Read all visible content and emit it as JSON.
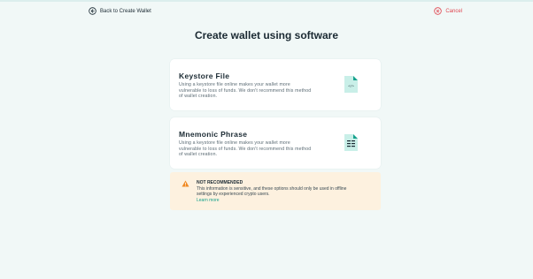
{
  "header": {
    "back_label": "Back to Create Wallet",
    "cancel_label": "Cancel"
  },
  "page": {
    "title": "Create wallet using software"
  },
  "options": [
    {
      "title": "Keystore File",
      "description": "Using a keystore file online makes your wallet more vulnerable to loss of funds. We don't recommend this method of wallet creation.",
      "icon": "keystore-file-icon"
    },
    {
      "title": "Mnemonic Phrase",
      "description": "Using a keystore file online makes your wallet more vulnerable to loss of funds. We don't recommend this method of wallet creation.",
      "icon": "mnemonic-phrase-icon"
    }
  ],
  "warning": {
    "title": "NOT RECOMMENDED",
    "body": "This information is sensitive, and these options should only be used in offline settings by experienced crypto users.",
    "link_label": "Learn more",
    "icon": "warning-icon"
  },
  "colors": {
    "background": "#f1f8f7",
    "accent": "#15a18c",
    "cancel": "#e0454f",
    "warning_bg": "#fdf1df",
    "warning_icon": "#f08a24"
  }
}
